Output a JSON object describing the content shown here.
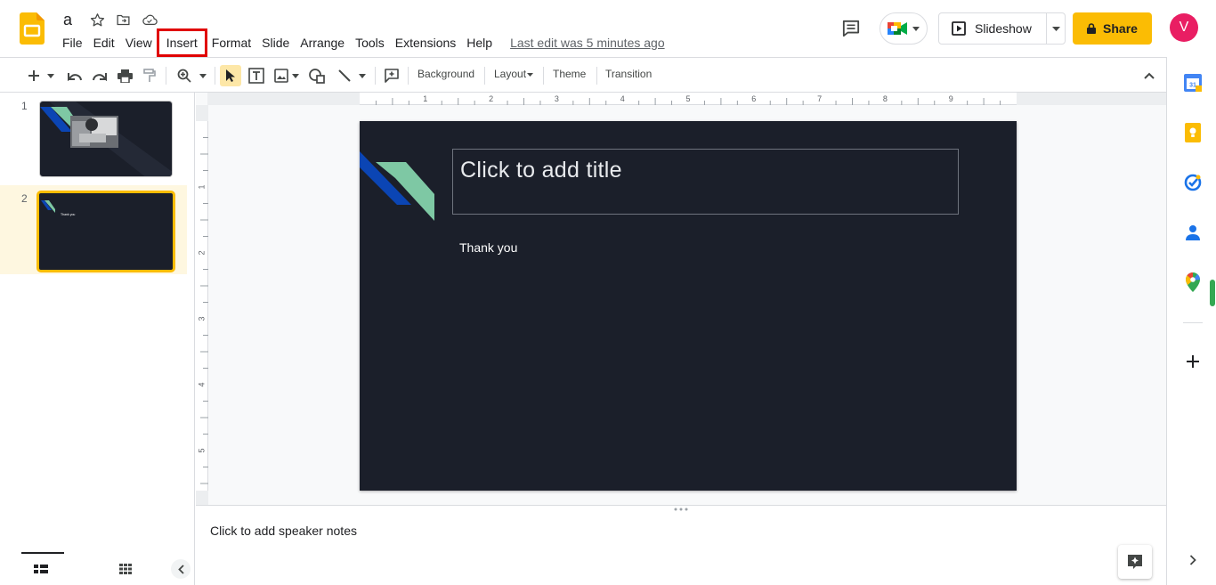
{
  "doc": {
    "title": "a"
  },
  "menu": [
    "File",
    "Edit",
    "View",
    "Insert",
    "Format",
    "Slide",
    "Arrange",
    "Tools",
    "Extensions",
    "Help"
  ],
  "last_edit": "Last edit was 5 minutes ago",
  "header": {
    "slideshow_label": "Slideshow",
    "share_label": "Share",
    "avatar_initial": "V"
  },
  "toolbar": {
    "background_label": "Background",
    "layout_label": "Layout",
    "theme_label": "Theme",
    "transition_label": "Transition"
  },
  "ruler": {
    "horizontal_ticks": [
      "1",
      "2",
      "3",
      "4",
      "5",
      "6",
      "7",
      "8",
      "9"
    ],
    "vertical_ticks": [
      "1",
      "2",
      "3",
      "4",
      "5"
    ]
  },
  "filmstrip": {
    "slides": [
      {
        "number": "1",
        "selected": false
      },
      {
        "number": "2",
        "selected": true
      }
    ],
    "slide2_thumb_text": "Thank you"
  },
  "slide": {
    "title_placeholder": "Click to add title",
    "body": "Thank you"
  },
  "notes": {
    "placeholder": "Click to add speaker notes"
  },
  "colors": {
    "accent": "#fbbc04",
    "highlight_box": "#e00000",
    "slide_bg": "#1b1f2a",
    "stripe_blue": "#0b45b4",
    "stripe_green": "#7ec8a4",
    "avatar": "#e91e63"
  },
  "icons": [
    "slides-logo-icon",
    "star-icon",
    "move-folder-icon",
    "cloud-saved-icon",
    "comments-icon",
    "meet-icon",
    "present-icon",
    "lock-icon",
    "calendar-icon",
    "keep-icon",
    "tasks-icon",
    "contacts-icon",
    "maps-icon",
    "plus-icon",
    "explore-icon"
  ]
}
